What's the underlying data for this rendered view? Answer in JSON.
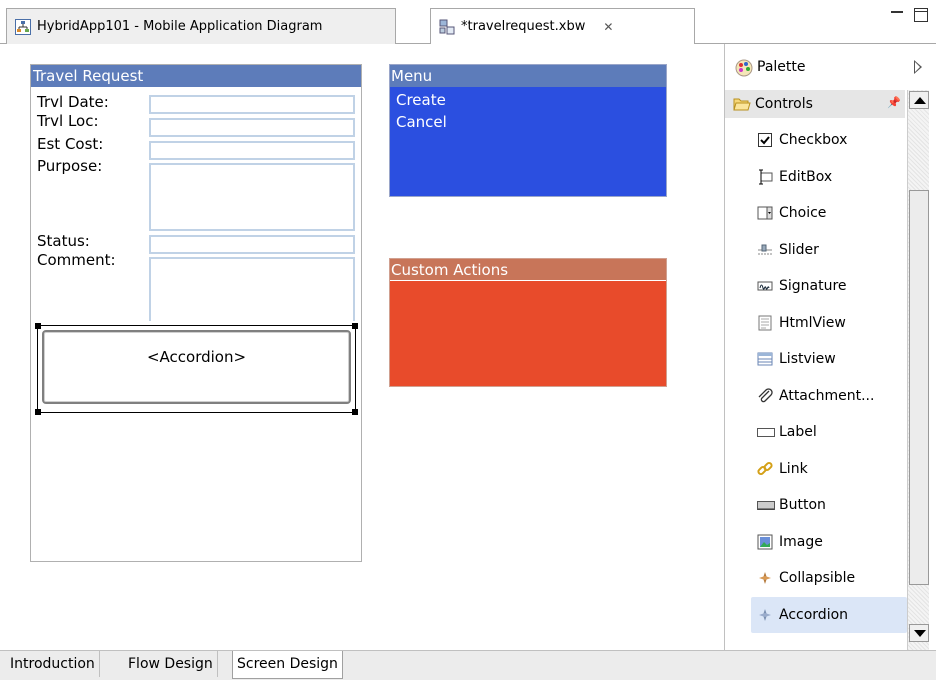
{
  "editor_tabs": [
    {
      "label": "HybridApp101 - Mobile Application Diagram",
      "icon": "diagram-icon"
    },
    {
      "label": "*travelrequest.xbw",
      "icon": "xbw-file-icon",
      "close": "✕"
    }
  ],
  "travel_request": {
    "title": "Travel Request",
    "labels": [
      "Trvl Date:",
      "Trvl Loc:",
      "Est Cost:",
      "Purpose:",
      "Status:",
      "Comment:"
    ],
    "accordion": "<Accordion>"
  },
  "menu": {
    "title": "Menu",
    "items": [
      "Create",
      "Cancel"
    ]
  },
  "custom_actions": {
    "title": "Custom Actions"
  },
  "palette": {
    "title": "Palette",
    "drawer": "Controls",
    "items": [
      {
        "label": "Checkbox",
        "icon": "checkbox-icon"
      },
      {
        "label": "EditBox",
        "icon": "editbox-icon"
      },
      {
        "label": "Choice",
        "icon": "choice-icon"
      },
      {
        "label": "Slider",
        "icon": "slider-icon"
      },
      {
        "label": "Signature",
        "icon": "signature-icon"
      },
      {
        "label": "HtmlView",
        "icon": "htmlview-icon"
      },
      {
        "label": "Listview",
        "icon": "listview-icon"
      },
      {
        "label": "Attachment...",
        "icon": "attachment-icon"
      },
      {
        "label": "Label",
        "icon": "label-icon"
      },
      {
        "label": "Link",
        "icon": "link-icon"
      },
      {
        "label": "Button",
        "icon": "button-icon"
      },
      {
        "label": "Image",
        "icon": "image-icon"
      },
      {
        "label": "Collapsible",
        "icon": "collapsible-icon"
      },
      {
        "label": "Accordion",
        "icon": "accordion-icon"
      }
    ],
    "selected": "Accordion"
  },
  "bottom_tabs": [
    "Introduction",
    "Flow Design",
    "Screen Design"
  ],
  "active_bottom_tab": "Screen Design",
  "colors": {
    "screen_header": "#5d7cba",
    "menu_body": "#2b4fe0",
    "custom_actions_header": "#c87559",
    "custom_actions_body": "#e84b2b",
    "input_border": "#c0d2e6",
    "selected_palette_item": "#dbe6f7"
  }
}
